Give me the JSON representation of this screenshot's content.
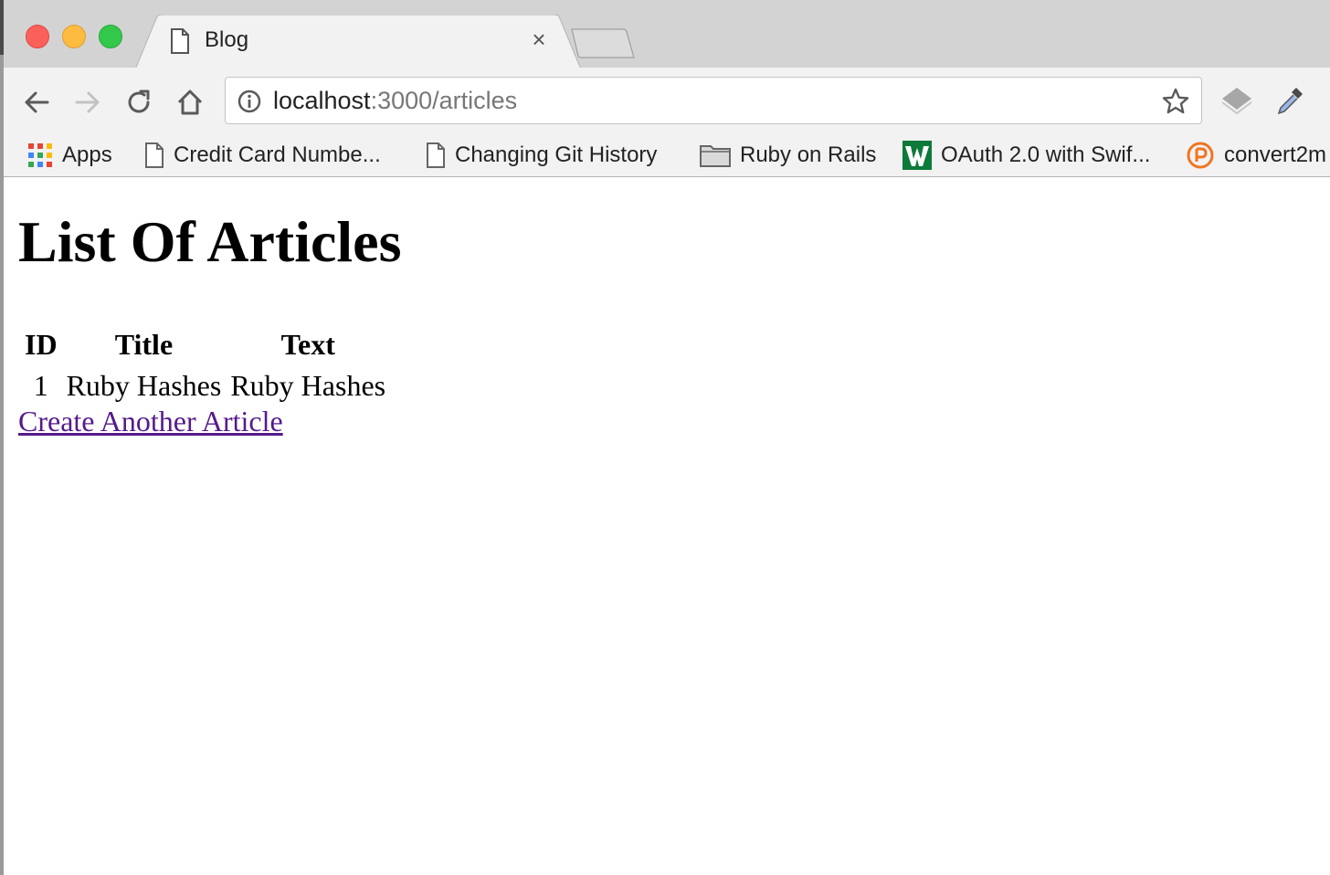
{
  "browser": {
    "tab": {
      "title": "Blog",
      "close_label": "×"
    },
    "url": {
      "host": "localhost",
      "path": ":3000/articles"
    },
    "bookmarks": [
      {
        "label": "Apps",
        "icon": "apps-grid-icon"
      },
      {
        "label": "Credit Card Numbe...",
        "icon": "page-icon"
      },
      {
        "label": "Changing Git History",
        "icon": "page-icon"
      },
      {
        "label": "Ruby on Rails",
        "icon": "folder-icon"
      },
      {
        "label": "OAuth 2.0 with Swif...",
        "icon": "site-logo-icon"
      },
      {
        "label": "convert2m",
        "icon": "convert-logo-icon"
      }
    ]
  },
  "page": {
    "heading": "List Of Articles",
    "table": {
      "headers": [
        "ID",
        "Title",
        "Text"
      ],
      "rows": [
        [
          "1",
          "Ruby Hashes",
          "Ruby Hashes"
        ]
      ]
    },
    "create_link": "Create Another Article"
  },
  "colors": {
    "link_visited": "#551a8b",
    "chrome_bg": "#d3d3d3",
    "toolbar_bg": "#f2f2f2"
  }
}
